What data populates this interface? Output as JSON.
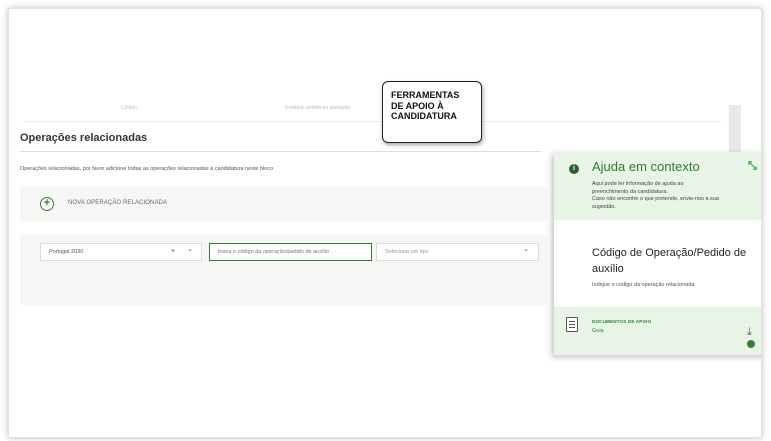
{
  "background_rows": [
    "Código",
    "Entidade pedido da operação"
  ],
  "section": {
    "title": "Operações relacionadas",
    "description": "Operações relacionadas, por favor adicione todas as operações relacionadas à candidatura neste bloco"
  },
  "add_operation": {
    "label": "NOVA OPERAÇÃO RELACIONADA",
    "icon": "plus-circle-icon"
  },
  "form": {
    "program_select": {
      "value": "Portugal 2030",
      "clear_glyph": "×",
      "chevron_glyph": "⌄"
    },
    "code_input": {
      "placeholder": "Insira o código da operação/pedido de auxílio",
      "value": ""
    },
    "type_select": {
      "placeholder": "Selecione um tipo",
      "chevron_glyph": "⌄"
    }
  },
  "callout": {
    "lines": [
      "FERRAMENTAS",
      "DE APOIO À",
      "CANDIDATURA"
    ]
  },
  "help": {
    "title": "Ajuda em contexto",
    "info_glyph": "i",
    "collapse_glyph": "⤡",
    "text_lines": [
      "Aqui pode ler informação de ajuda ao",
      "preenchimento da candidatura.",
      "Caso não encontre o que pretende, envie-nos a sua",
      "sugestão."
    ],
    "field_title": "Código de Operação/Pedido de auxílio",
    "field_description": "Indique o código da operação relacionada",
    "docs_label": "DOCUMENTOS DE APOIO",
    "docs_link": "Guia",
    "download_glyph": "⤓"
  },
  "colors": {
    "accent": "#2e7d32",
    "help_bg": "#e8f4e5",
    "row_bg": "#f6f7f5"
  }
}
